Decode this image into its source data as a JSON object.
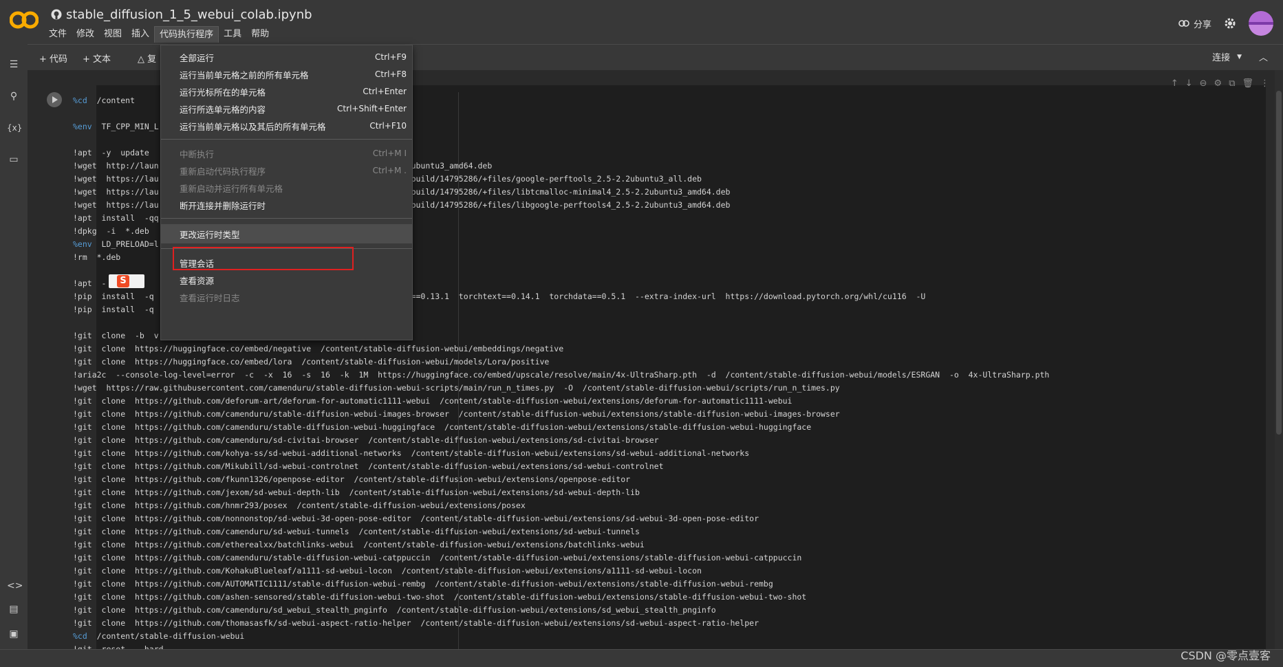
{
  "header": {
    "title": "stable_diffusion_1_5_webui_colab.ipynb",
    "share_label": "分享"
  },
  "menubar": [
    "文件",
    "修改",
    "视图",
    "插入",
    "代码执行程序",
    "工具",
    "帮助"
  ],
  "toolbar": {
    "add_code": "+ 代码",
    "add_text": "+ 文本",
    "copy_drive": "复",
    "connect": "连接"
  },
  "dropdown": {
    "items": [
      {
        "label": "全部运行",
        "shortcut": "Ctrl+F9",
        "disabled": false
      },
      {
        "label": "运行当前单元格之前的所有单元格",
        "shortcut": "Ctrl+F8",
        "disabled": false
      },
      {
        "label": "运行光标所在的单元格",
        "shortcut": "Ctrl+Enter",
        "disabled": false
      },
      {
        "label": "运行所选单元格的内容",
        "shortcut": "Ctrl+Shift+Enter",
        "disabled": false
      },
      {
        "label": "运行当前单元格以及其后的所有单元格",
        "shortcut": "Ctrl+F10",
        "disabled": false
      },
      {
        "label": "中断执行",
        "shortcut": "Ctrl+M I",
        "disabled": true
      },
      {
        "label": "重新启动代码执行程序",
        "shortcut": "Ctrl+M .",
        "disabled": true
      },
      {
        "label": "重新启动并运行所有单元格",
        "shortcut": "",
        "disabled": true
      },
      {
        "label": "断开连接并删除运行时",
        "shortcut": "",
        "disabled": false
      },
      {
        "label": "更改运行时类型",
        "shortcut": "",
        "disabled": false
      },
      {
        "label": "管理会话",
        "shortcut": "",
        "disabled": false
      },
      {
        "label": "查看资源",
        "shortcut": "",
        "disabled": false
      },
      {
        "label": "查看运行时日志",
        "shortcut": "",
        "disabled": true
      }
    ]
  },
  "code_lines": [
    "%cd  /content",
    "",
    "%env  TF_CPP_MIN_L",
    "",
    "!apt  -y  update",
    "!wget  http://laun                                              2.5-2.2ubuntu3_amd64.deb",
    "!wget  https://lau                                              untu3/+build/14795286/+files/google-perftools_2.5-2.2ubuntu3_all.deb",
    "!wget  https://lau                                              untu3/+build/14795286/+files/libtcmalloc-minimal4_2.5-2.2ubuntu3_amd64.deb",
    "!wget  https://lau                                              untu3/+build/14795286/+files/libgoogle-perftools4_2.5-2.2ubuntu3_amd64.deb",
    "!apt  install  -qq",
    "!dpkg  -i  *.deb",
    "%env  LD_PRELOAD=l",
    "!rm  *.deb",
    "",
    "!apt  -      ll",
    "!pip  install  -q                                               chaudio==0.13.1  torchtext==0.14.1  torchdata==0.5.1  --extra-index-url  https://download.pytorch.org/whl/cu116  -U",
    "!pip  install  -q",
    "",
    "!git  clone  -b  v                                              ebui",
    "!git  clone  https://huggingface.co/embed/negative  /content/stable-diffusion-webui/embeddings/negative",
    "!git  clone  https://huggingface.co/embed/lora  /content/stable-diffusion-webui/models/Lora/positive",
    "!aria2c  --console-log-level=error  -c  -x  16  -s  16  -k  1M  https://huggingface.co/embed/upscale/resolve/main/4x-UltraSharp.pth  -d  /content/stable-diffusion-webui/models/ESRGAN  -o  4x-UltraSharp.pth",
    "!wget  https://raw.githubusercontent.com/camenduru/stable-diffusion-webui-scripts/main/run_n_times.py  -O  /content/stable-diffusion-webui/scripts/run_n_times.py",
    "!git  clone  https://github.com/deforum-art/deforum-for-automatic1111-webui  /content/stable-diffusion-webui/extensions/deforum-for-automatic1111-webui",
    "!git  clone  https://github.com/camenduru/stable-diffusion-webui-images-browser  /content/stable-diffusion-webui/extensions/stable-diffusion-webui-images-browser",
    "!git  clone  https://github.com/camenduru/stable-diffusion-webui-huggingface  /content/stable-diffusion-webui/extensions/stable-diffusion-webui-huggingface",
    "!git  clone  https://github.com/camenduru/sd-civitai-browser  /content/stable-diffusion-webui/extensions/sd-civitai-browser",
    "!git  clone  https://github.com/kohya-ss/sd-webui-additional-networks  /content/stable-diffusion-webui/extensions/sd-webui-additional-networks",
    "!git  clone  https://github.com/Mikubill/sd-webui-controlnet  /content/stable-diffusion-webui/extensions/sd-webui-controlnet",
    "!git  clone  https://github.com/fkunn1326/openpose-editor  /content/stable-diffusion-webui/extensions/openpose-editor",
    "!git  clone  https://github.com/jexom/sd-webui-depth-lib  /content/stable-diffusion-webui/extensions/sd-webui-depth-lib",
    "!git  clone  https://github.com/hnmr293/posex  /content/stable-diffusion-webui/extensions/posex",
    "!git  clone  https://github.com/nonnonstop/sd-webui-3d-open-pose-editor  /content/stable-diffusion-webui/extensions/sd-webui-3d-open-pose-editor",
    "!git  clone  https://github.com/camenduru/sd-webui-tunnels  /content/stable-diffusion-webui/extensions/sd-webui-tunnels",
    "!git  clone  https://github.com/etherealxx/batchlinks-webui  /content/stable-diffusion-webui/extensions/batchlinks-webui",
    "!git  clone  https://github.com/camenduru/stable-diffusion-webui-catppuccin  /content/stable-diffusion-webui/extensions/stable-diffusion-webui-catppuccin",
    "!git  clone  https://github.com/KohakuBlueleaf/a1111-sd-webui-locon  /content/stable-diffusion-webui/extensions/a1111-sd-webui-locon",
    "!git  clone  https://github.com/AUTOMATIC1111/stable-diffusion-webui-rembg  /content/stable-diffusion-webui/extensions/stable-diffusion-webui-rembg",
    "!git  clone  https://github.com/ashen-sensored/stable-diffusion-webui-two-shot  /content/stable-diffusion-webui/extensions/stable-diffusion-webui-two-shot",
    "!git  clone  https://github.com/camenduru/sd_webui_stealth_pnginfo  /content/stable-diffusion-webui/extensions/sd_webui_stealth_pnginfo",
    "!git  clone  https://github.com/thomasasfk/sd-webui-aspect-ratio-helper  /content/stable-diffusion-webui/extensions/sd-webui-aspect-ratio-helper",
    "%cd  /content/stable-diffusion-webui",
    "!git  reset  --hard"
  ],
  "badge_letter": "S",
  "watermark": "CSDN @零点壹客",
  "colors": {
    "bg": "#1e1e1e",
    "chrome": "#383838",
    "highlight_box": "#e02020",
    "magic_keyword": "#569cd6"
  }
}
